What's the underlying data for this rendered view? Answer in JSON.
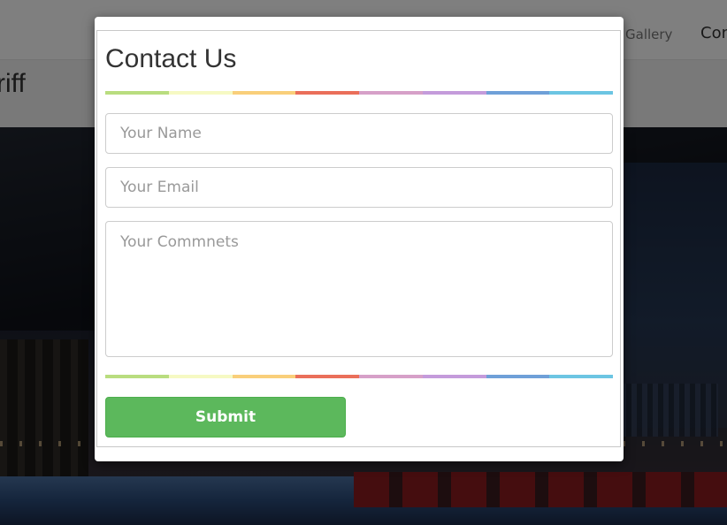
{
  "background_page": {
    "nav": {
      "gallery_label": "Gallery",
      "contact_label": "Contact"
    },
    "page_title": "riff"
  },
  "modal": {
    "title": "Contact Us",
    "form": {
      "name_placeholder": "Your Name",
      "email_placeholder": "Your Email",
      "comments_placeholder": "Your Commnets",
      "name_value": "",
      "email_value": "",
      "comments_value": ""
    },
    "submit_label": "Submit"
  },
  "colors": {
    "submit_bg": "#5cb85c",
    "divider_stripes": [
      "#b9dd7f",
      "#f6f9c3",
      "#f9cf7a",
      "#ea6f5a",
      "#d6a0c8",
      "#c49bdb",
      "#6fa0d8",
      "#6cc5e3"
    ]
  }
}
